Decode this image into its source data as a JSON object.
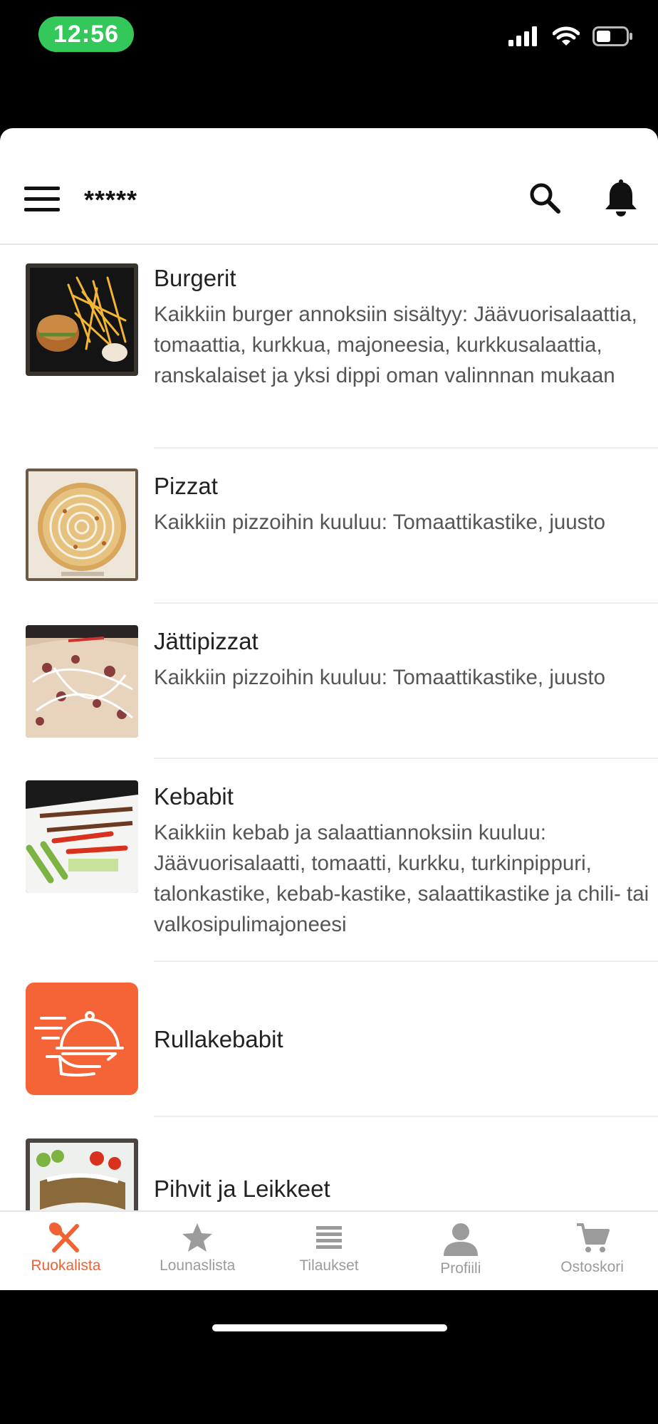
{
  "status_bar": {
    "time": "12:56"
  },
  "header": {
    "brand": "*****"
  },
  "categories": [
    {
      "title": "Burgerit",
      "description": "Kaikkiin burger annoksiin sisältyy: Jäävuorisalaattia, tomaattia, kurkkua, majoneesia, kurkkusalaattia, ranskalaiset ja yksi dippi oman valinnnan mukaan",
      "image": "burger-photo"
    },
    {
      "title": "Pizzat",
      "description": "Kaikkiin pizzoihin kuuluu: Tomaattikastike, juusto",
      "image": "pizza-photo"
    },
    {
      "title": "Jättipizzat",
      "description": "Kaikkiin pizzoihin kuuluu: Tomaattikastike, juusto",
      "image": "giant-pizza-photo"
    },
    {
      "title": "Kebabit",
      "description": "Kaikkiin kebab ja salaattiannoksiin kuuluu: Jäävuorisalaatti, tomaatti, kurkku, turkinpippuri, talonkastike, kebab-kastike, salaattikastike ja chili- tai valkosipulimajoneesi",
      "image": "kebab-photo"
    },
    {
      "title": "Rullakebabit",
      "description": "",
      "image": "serving-cloche-icon"
    },
    {
      "title": "Pihvit ja Leikkeet",
      "description": "",
      "image": "steak-photo"
    }
  ],
  "tabs": [
    {
      "label": "Ruokalista",
      "icon": "fork-knife-icon",
      "active": true
    },
    {
      "label": "Lounaslista",
      "icon": "star-icon",
      "active": false
    },
    {
      "label": "Tilaukset",
      "icon": "list-icon",
      "active": false
    },
    {
      "label": "Profiili",
      "icon": "person-icon",
      "active": false
    },
    {
      "label": "Ostoskori",
      "icon": "cart-icon",
      "active": false
    }
  ],
  "colors": {
    "accent": "#f06234",
    "inactive": "#9b9b9b",
    "status_pill": "#34c759"
  }
}
